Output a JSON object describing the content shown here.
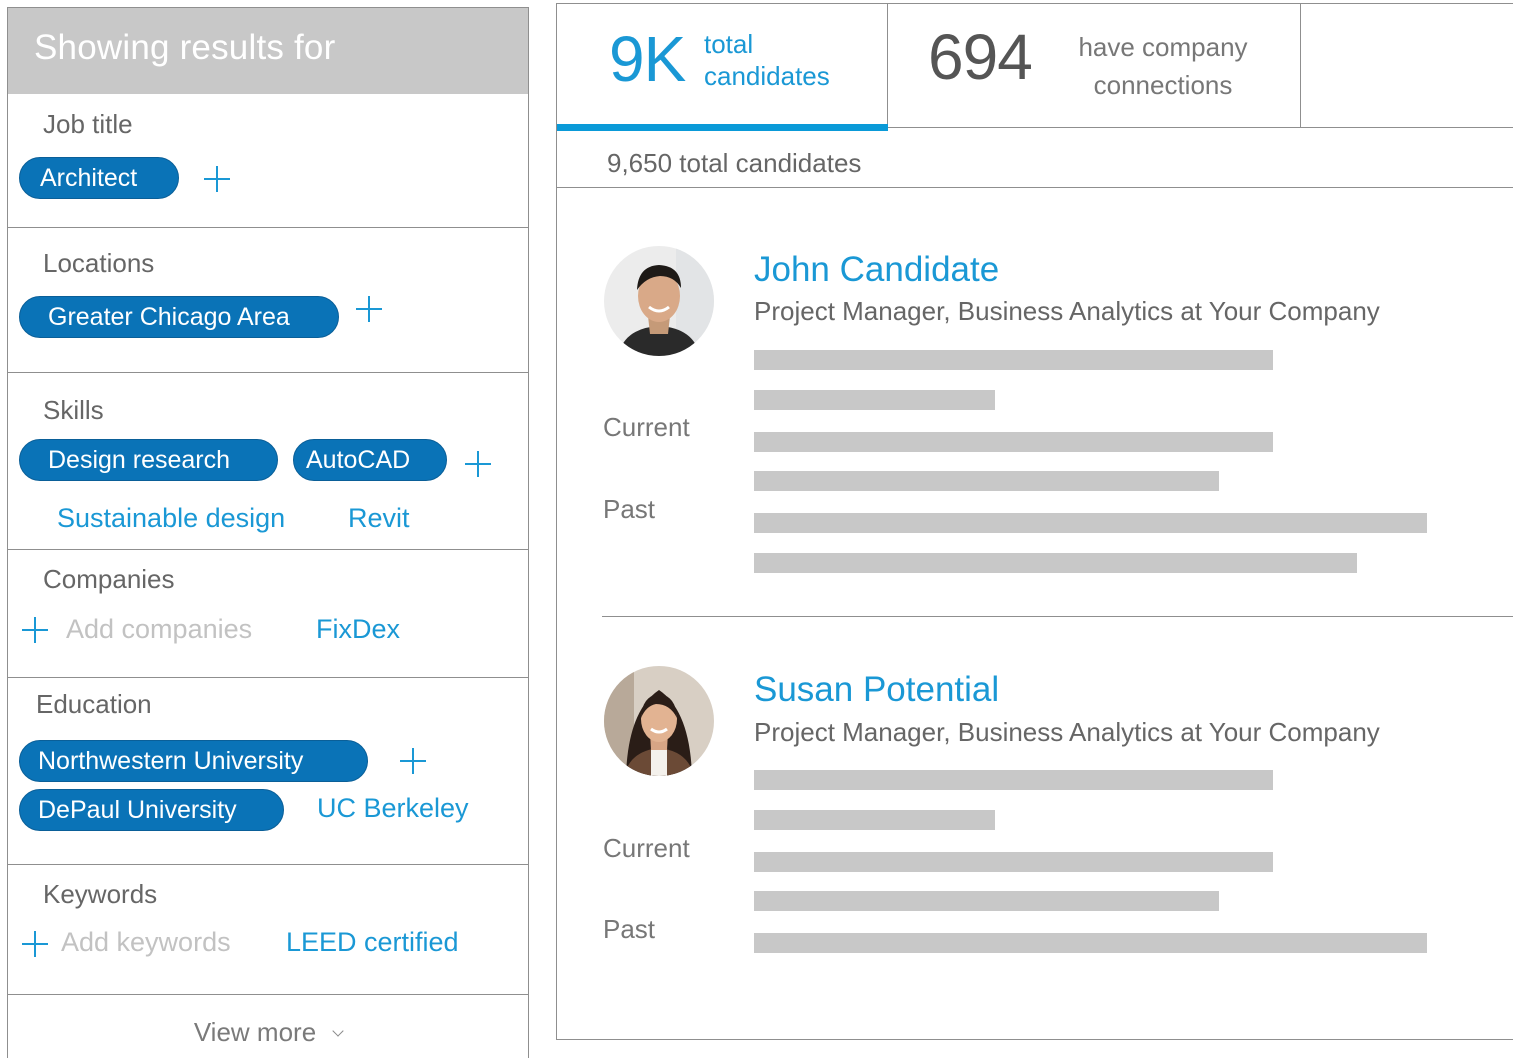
{
  "filters": {
    "header": "Showing results for",
    "job_title": {
      "title": "Job title",
      "selected": [
        "Architect"
      ]
    },
    "locations": {
      "title": "Locations",
      "selected": [
        "Greater Chicago Area"
      ]
    },
    "skills": {
      "title": "Skills",
      "selected": [
        "Design research",
        "AutoCAD"
      ],
      "suggested": [
        "Sustainable design",
        "Revit"
      ]
    },
    "companies": {
      "title": "Companies",
      "placeholder": "Add companies",
      "suggested": [
        "FixDex"
      ]
    },
    "education": {
      "title": "Education",
      "selected": [
        "Northwestern University",
        "DePaul University"
      ],
      "suggested": [
        "UC Berkeley"
      ]
    },
    "keywords": {
      "title": "Keywords",
      "placeholder": "Add keywords",
      "suggested": [
        "LEED certified"
      ]
    },
    "view_more": "View more"
  },
  "stats": {
    "tabs": [
      {
        "big": "9K",
        "small": "total candidates",
        "active": true
      },
      {
        "big": "694",
        "small": "have company connections",
        "active": false
      }
    ],
    "total_line": "9,650 total candidates"
  },
  "candidates": [
    {
      "name": "John Candidate",
      "headline": "Project Manager, Business Analytics at Your Company",
      "current_label": "Current",
      "past_label": "Past"
    },
    {
      "name": "Susan Potential",
      "headline": "Project Manager, Business Analytics at Your Company",
      "current_label": "Current",
      "past_label": "Past"
    }
  ],
  "colors": {
    "accent": "#1a98d5",
    "pill": "#0a73b7",
    "header_gray": "#c8c8c8",
    "skeleton": "#c8c8c8"
  },
  "icons": [
    "plus-icon",
    "chevron-down-icon"
  ]
}
